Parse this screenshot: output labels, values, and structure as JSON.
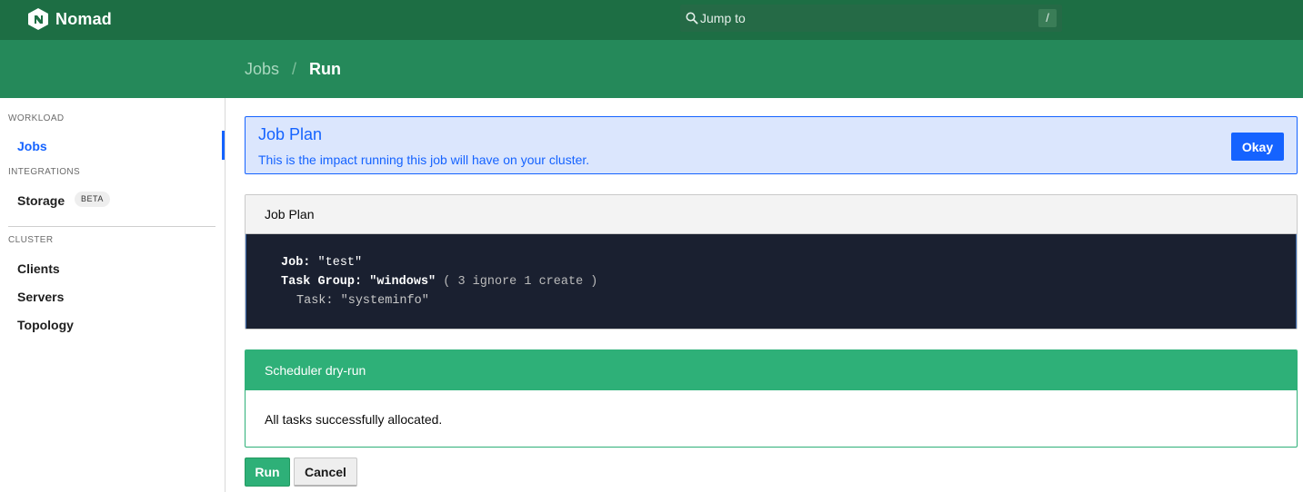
{
  "app": {
    "name": "Nomad"
  },
  "search": {
    "placeholder": "Jump to",
    "shortcut": "/"
  },
  "breadcrumb": {
    "parent": "Jobs",
    "separator": "/",
    "current": "Run"
  },
  "sidebar": {
    "sections": [
      {
        "label": "WORKLOAD",
        "items": [
          {
            "label": "Jobs",
            "active": true
          }
        ]
      },
      {
        "label": "INTEGRATIONS",
        "items": [
          {
            "label": "Storage",
            "badge": "BETA"
          }
        ]
      },
      {
        "label": "CLUSTER",
        "items": [
          {
            "label": "Clients"
          },
          {
            "label": "Servers"
          },
          {
            "label": "Topology"
          }
        ]
      }
    ]
  },
  "alert": {
    "title": "Job Plan",
    "message": "This is the impact running this job will have on your cluster.",
    "button": "Okay"
  },
  "plan": {
    "header": "Job Plan",
    "job_key": "Job:",
    "job_value": "\"test\"",
    "group_key": "Task Group:",
    "group_value": "\"windows\"",
    "group_summary": "( 3 ignore 1 create )",
    "task_key": "Task:",
    "task_value": "\"systeminfo\""
  },
  "dry_run": {
    "header": "Scheduler dry-run",
    "message": "All tasks successfully allocated."
  },
  "actions": {
    "run": "Run",
    "cancel": "Cancel"
  },
  "colors": {
    "topbar": "#1d6e44",
    "subheader": "#25895a",
    "accent_blue": "#1563ff",
    "success_green": "#2eb078",
    "code_bg": "#1a2030"
  }
}
